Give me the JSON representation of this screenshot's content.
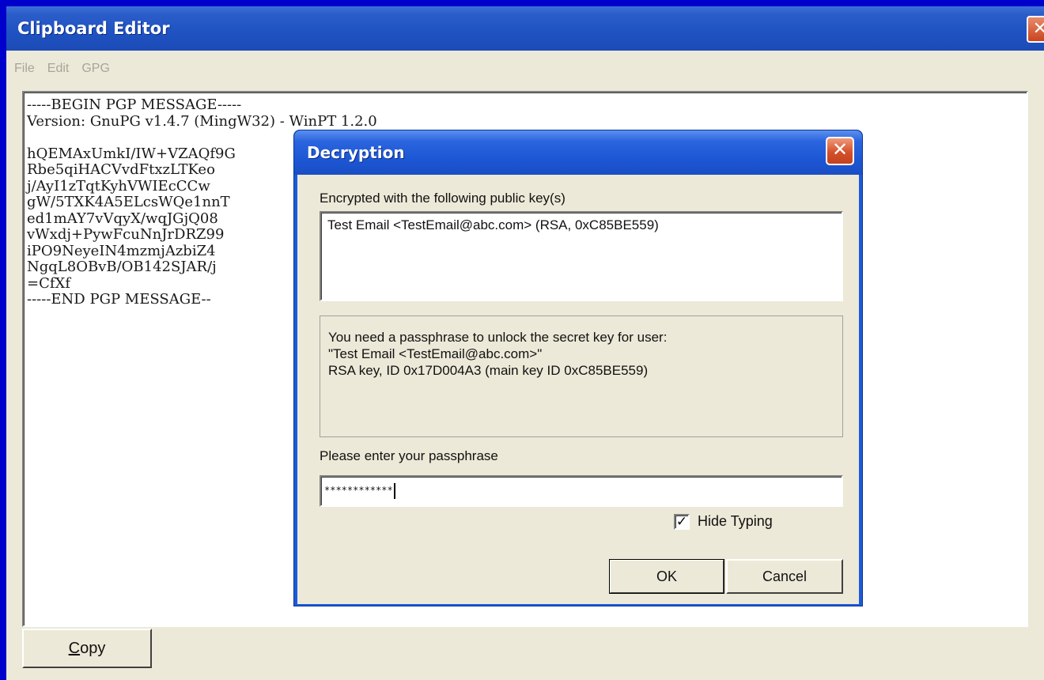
{
  "main_window": {
    "title": "Clipboard Editor",
    "menu": [
      "File",
      "Edit",
      "GPG"
    ],
    "editor_lines": [
      "-----BEGIN PGP MESSAGE-----",
      "Version: GnuPG v1.4.7 (MingW32) - WinPT 1.2.0",
      "",
      "hQEMAxUmkI/IW+VZAQf9G",
      "Rbe5qiHACVvdFtxzLTKeo",
      "j/AyI1zTqtKyhVWIEcCCw",
      "gW/5TXK4A5ELcsWQe1nnT",
      "ed1mAY7vVqyX/wqJGjQ08",
      "vWxdj+PywFcuNnJrDRZ99",
      "iPO9NeyeIN4mzmjAzbiZ4",
      "NgqL8OBvB/OB142SJAR/j",
      "=CfXf",
      "-----END PGP MESSAGE--"
    ],
    "copy_button": "Copy"
  },
  "dialog": {
    "title": "Decryption",
    "close_glyph": "✕",
    "encrypted_label": "Encrypted with the following public key(s)",
    "encrypted_keys": [
      "Test Email <TestEmail@abc.com> (RSA, 0xC85BE559)"
    ],
    "passphrase_info": [
      "You need a passphrase to unlock the secret key for user:",
      "\"Test Email <TestEmail@abc.com>\"",
      "RSA key, ID 0x17D004A3 (main key ID 0xC85BE559)"
    ],
    "passphrase_label": "Please enter your passphrase",
    "passphrase_value": "************",
    "hide_typing_label": "Hide Typing",
    "hide_typing_checked": true,
    "ok_label": "OK",
    "cancel_label": "Cancel"
  },
  "colors": {
    "desktop": "#0000cc",
    "titlebar": "#1f52c2",
    "window_face": "#ece9d8"
  }
}
